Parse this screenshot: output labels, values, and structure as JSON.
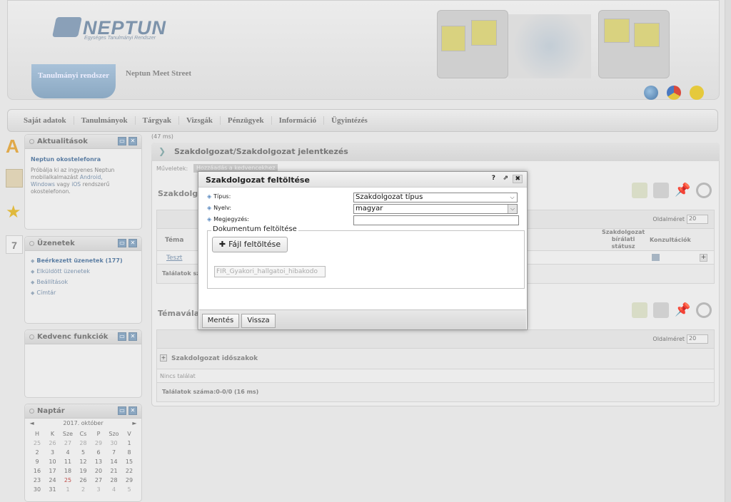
{
  "header": {
    "logo_text": "NEPTUN",
    "logo_sub": "Egységes Tanulmányi Rendszer",
    "tab_active": "Tanulmányi rendszer",
    "tab_other": "Neptun Meet Street"
  },
  "menu": [
    "Saját adatok",
    "Tanulmányok",
    "Tárgyak",
    "Vizsgák",
    "Pénzügyek",
    "Információ",
    "Ügyintézés"
  ],
  "timing": "(47 ms)",
  "panels": {
    "news": {
      "title": "Aktualitások",
      "headline": "Neptun okostelefonra",
      "text1": "Próbálja ki az ingyenes Neptun",
      "text2": "mobilalkalmazást",
      "link_android": "Android,",
      "link_windows": "Windows",
      "text3": "vagy",
      "link_ios": "iOS",
      "text4": "rendszerű",
      "text5": "okostelefonon."
    },
    "messages": {
      "title": "Üzenetek",
      "items": [
        "Beérkezett üzenetek (177)",
        "Elküldött üzenetek",
        "Beállítások",
        "Címtár"
      ]
    },
    "favorites": {
      "title": "Kedvenc funkciók"
    },
    "calendar": {
      "title": "Naptár",
      "month": "2017. október",
      "prev": "◄",
      "next": "►",
      "days": [
        "H",
        "K",
        "Sze",
        "Cs",
        "P",
        "Szo",
        "V"
      ],
      "weeks": [
        [
          "25",
          "26",
          "27",
          "28",
          "29",
          "30",
          "1"
        ],
        [
          "2",
          "3",
          "4",
          "5",
          "6",
          "7",
          "8"
        ],
        [
          "9",
          "10",
          "11",
          "12",
          "13",
          "14",
          "15"
        ],
        [
          "16",
          "17",
          "18",
          "19",
          "20",
          "21",
          "22"
        ],
        [
          "23",
          "24",
          "25",
          "26",
          "27",
          "28",
          "29"
        ],
        [
          "30",
          "31",
          "1",
          "2",
          "3",
          "4",
          "5"
        ]
      ]
    }
  },
  "main": {
    "title": "Szakdolgozat/Szakdolgozat jelentkezés",
    "actions_label": "Műveletek:",
    "actions_button": "Hozzáadás a kedvencekhez",
    "section1_title": "Szakdolgo",
    "section2_title": "Témaválas",
    "page_size_label": "Oldalméret",
    "page_size_value": "20",
    "grid1": {
      "col_tema": "Téma",
      "col_status1": "Szakdolgozat",
      "col_status2": "bírálati",
      "col_status3": "státusz",
      "col_konz": "Konzultációk",
      "row_link": "Teszt",
      "footer": "Találatok sza"
    },
    "grid2": {
      "group": "Szakdolgozat időszakok",
      "empty": "Nincs találat",
      "footer": "Találatok száma:0-0/0 (16 ms)"
    }
  },
  "modal": {
    "title": "Szakdolgozat feltöltése",
    "help": "?",
    "popout": "⇗",
    "close": "✖",
    "fields": {
      "tipus_label": "Típus:",
      "tipus_value": "Szakdolgozat típus",
      "nyelv_label": "Nyelv:",
      "nyelv_value": "magyar",
      "megj_label": "Megjegyzés:",
      "megj_value": ""
    },
    "upload_legend": "Dokumentum feltöltése",
    "upload_button": "Fájl feltöltése",
    "file_name": "FIR_Gyakori_hallgatoi_hibakodo",
    "save": "Mentés",
    "back": "Vissza"
  }
}
